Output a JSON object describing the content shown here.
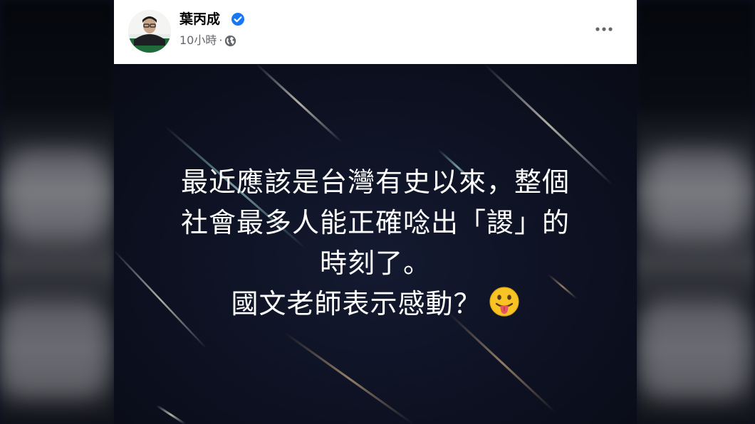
{
  "post": {
    "author_name": "葉丙成",
    "timestamp": "10小時",
    "separator": "·",
    "text_lines": [
      "最近應該是台灣有史以來，整個",
      "社會最多人能正確唸出「謖」的",
      "時刻了。",
      "國文老師表示感動？"
    ]
  },
  "icons": {
    "verified": "verified-badge-icon",
    "privacy": "globe-icon",
    "more": "more-options-icon",
    "emoji": "tongue-out-emoji"
  },
  "colors": {
    "verified_blue": "#1877f2",
    "secondary_text": "#65676b",
    "image_background": "#0d1122",
    "text_on_image": "#ffffff"
  }
}
